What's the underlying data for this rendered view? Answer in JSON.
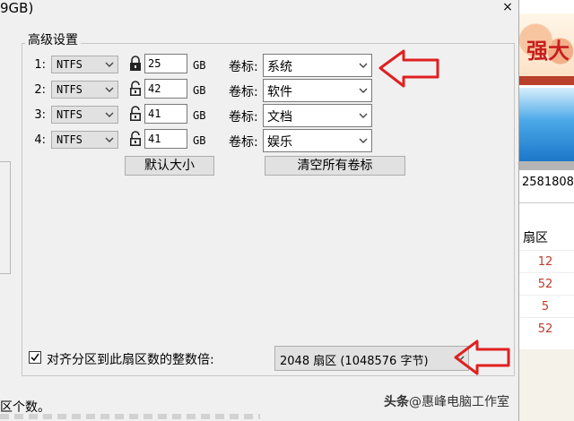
{
  "window": {
    "title_fragment": "9GB)",
    "close_glyph": "×"
  },
  "group": {
    "title": "高级设置"
  },
  "partitions": [
    {
      "index": "1:",
      "fs": "NTFS",
      "locked": true,
      "size": "25",
      "unit": "GB",
      "label_key": "卷标:",
      "label": "系统"
    },
    {
      "index": "2:",
      "fs": "NTFS",
      "locked": false,
      "size": "42",
      "unit": "GB",
      "label_key": "卷标:",
      "label": "软件"
    },
    {
      "index": "3:",
      "fs": "NTFS",
      "locked": false,
      "size": "41",
      "unit": "GB",
      "label_key": "卷标:",
      "label": "文档"
    },
    {
      "index": "4:",
      "fs": "NTFS",
      "locked": false,
      "size": "41",
      "unit": "GB",
      "label_key": "卷标:",
      "label": "娱乐"
    }
  ],
  "buttons": {
    "default_size": "默认大小",
    "clear_labels": "清空所有卷标"
  },
  "align": {
    "checked": true,
    "label": "对齐分区到此扇区数的整数倍:",
    "value": "2048 扇区 (1048576 字节)"
  },
  "background": {
    "banner_text": "强大",
    "number": "2581808",
    "column_header": "扇区",
    "cells": [
      "12",
      "52",
      "5",
      "52"
    ],
    "bottom_text": "区个数。"
  },
  "watermark": {
    "head": "头条",
    "rest": "@惠峰电脑工作室"
  },
  "colors": {
    "annotation_arrow": "#e02020",
    "accent_red": "#c0392b"
  }
}
